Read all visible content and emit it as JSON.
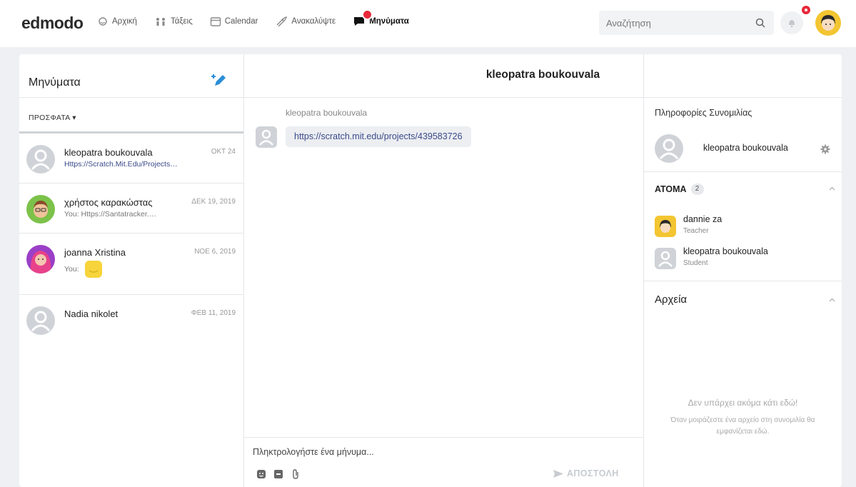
{
  "app": {
    "logo": "edmodo",
    "nav": [
      {
        "label": "Αρχική",
        "icon": "home-icon"
      },
      {
        "label": "Τάξεις",
        "icon": "classes-icon"
      },
      {
        "label": "Calendar",
        "icon": "calendar-icon"
      },
      {
        "label": "Ανακαλύψτε",
        "icon": "rocket-icon"
      },
      {
        "label": "Μηνύματα",
        "icon": "messages-icon",
        "active": true
      }
    ],
    "search_placeholder": "Αναζήτηση",
    "accent_color": "#3b4a8a",
    "badge_color": "#e8293a"
  },
  "sidebar": {
    "title": "Μηνύματα",
    "filter": "ΠΡΟΣΦΑΤΑ ▾",
    "conversations": [
      {
        "name": "kleopatra boukouvala",
        "date": "ΟΚΤ 24",
        "preview": "Https://Scratch.Mit.Edu/Projects…"
      },
      {
        "name": "χρήστος καρακώστας",
        "date": "ΔΕΚ 19, 2019",
        "preview": "You: Https://Santatracker.…"
      },
      {
        "name": "joanna Xristina",
        "date": "ΝΟΕ 6, 2019",
        "preview": "You:"
      },
      {
        "name": "Nadia nikolet",
        "date": "ΦΕΒ 11, 2019",
        "preview": ""
      }
    ]
  },
  "chat": {
    "title": "kleopatra boukouvala",
    "sender": "kleopatra boukouvala",
    "message": "https://scratch.mit.edu/projects/439583726",
    "composer_placeholder": "Πληκτρολογήστε ένα μήνυμα...",
    "send_label": "ΑΠΟΣΤΟΛΗ"
  },
  "info": {
    "heading": "Πληροφορίες Συνομιλίας",
    "name": "kleopatra boukouvala",
    "people_label": "ΑΤΟΜΑ",
    "people_count": "2",
    "people": [
      {
        "name": "dannie za",
        "role": "Teacher"
      },
      {
        "name": "kleopatra boukouvala",
        "role": "Student"
      }
    ],
    "files_label": "Αρχεία",
    "empty_title": "Δεν υπάρχει ακόμα κάτι εδώ!",
    "empty_text": "Όταν μοιράζεστε ένα αρχείο στη συνομιλία θα εμφανίζεται εδώ."
  }
}
